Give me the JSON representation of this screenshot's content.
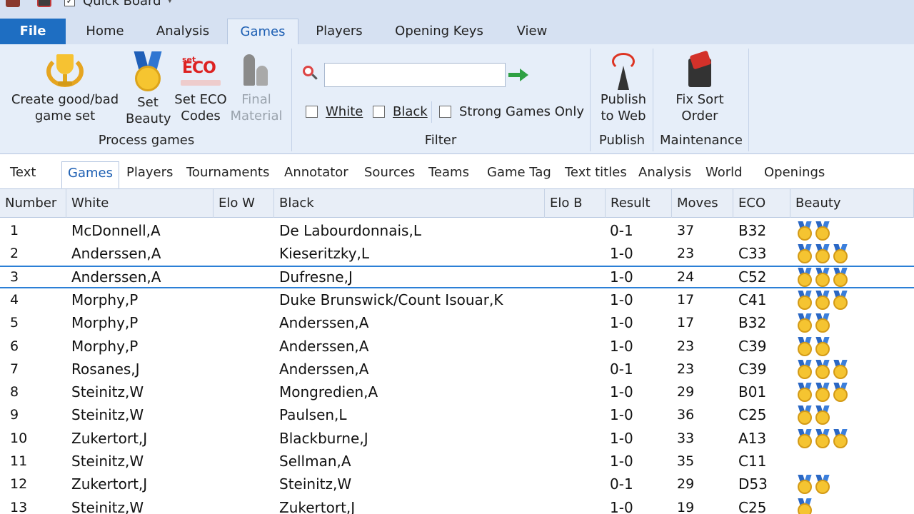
{
  "quick_access": {
    "label": "Quick Board",
    "checked": "✓"
  },
  "tabs": [
    {
      "label": "File"
    },
    {
      "label": "Home"
    },
    {
      "label": "Analysis"
    },
    {
      "label": "Games"
    },
    {
      "label": "Players"
    },
    {
      "label": "Opening Keys"
    },
    {
      "label": "View"
    }
  ],
  "ribbon": {
    "process_games": {
      "create_line1": "Create good/bad",
      "create_line2": "game set",
      "beauty_line1": "Set",
      "beauty_line2": "Beauty",
      "eco_line1": "Set ECO",
      "eco_line2": "Codes",
      "eco_icon_set": "set",
      "eco_icon_eco": "ECO",
      "final_line1": "Final",
      "final_line2": "Material",
      "group_label": "Process games"
    },
    "filter": {
      "search_value": "",
      "white_label": "White",
      "black_label": "Black",
      "strong_label": "Strong Games Only",
      "group_label": "Filter"
    },
    "publish": {
      "line1": "Publish",
      "line2": "to Web",
      "group_label": "Publish"
    },
    "maintenance": {
      "line1": "Fix Sort",
      "line2": "Order",
      "group_label": "Maintenance"
    }
  },
  "subtabs": [
    {
      "label": "Text"
    },
    {
      "label": "Games"
    },
    {
      "label": "Players"
    },
    {
      "label": "Tournaments"
    },
    {
      "label": "Annotator"
    },
    {
      "label": "Sources"
    },
    {
      "label": "Teams"
    },
    {
      "label": "Game Tag"
    },
    {
      "label": "Text titles"
    },
    {
      "label": "Analysis"
    },
    {
      "label": "World"
    },
    {
      "label": "Openings"
    }
  ],
  "table": {
    "columns": [
      "Number",
      "White",
      "Elo W",
      "Black",
      "Elo B",
      "Result",
      "Moves",
      "ECO",
      "Beauty"
    ],
    "rows": [
      {
        "number": "1",
        "white": "McDonnell,A",
        "black": "De Labourdonnais,L",
        "result": "0-1",
        "moves": "37",
        "eco": "B32",
        "beauty": 2
      },
      {
        "number": "2",
        "white": "Anderssen,A",
        "black": "Kieseritzky,L",
        "result": "1-0",
        "moves": "23",
        "eco": "C33",
        "beauty": 3
      },
      {
        "number": "3",
        "white": "Anderssen,A",
        "black": "Dufresne,J",
        "result": "1-0",
        "moves": "24",
        "eco": "C52",
        "beauty": 3
      },
      {
        "number": "4",
        "white": "Morphy,P",
        "black": "Duke Brunswick/Count Isouar,K",
        "result": "1-0",
        "moves": "17",
        "eco": "C41",
        "beauty": 3
      },
      {
        "number": "5",
        "white": "Morphy,P",
        "black": "Anderssen,A",
        "result": "1-0",
        "moves": "17",
        "eco": "B32",
        "beauty": 2
      },
      {
        "number": "6",
        "white": "Morphy,P",
        "black": "Anderssen,A",
        "result": "1-0",
        "moves": "23",
        "eco": "C39",
        "beauty": 2
      },
      {
        "number": "7",
        "white": "Rosanes,J",
        "black": "Anderssen,A",
        "result": "0-1",
        "moves": "23",
        "eco": "C39",
        "beauty": 3
      },
      {
        "number": "8",
        "white": "Steinitz,W",
        "black": "Mongredien,A",
        "result": "1-0",
        "moves": "29",
        "eco": "B01",
        "beauty": 3
      },
      {
        "number": "9",
        "white": "Steinitz,W",
        "black": "Paulsen,L",
        "result": "1-0",
        "moves": "36",
        "eco": "C25",
        "beauty": 2
      },
      {
        "number": "10",
        "white": "Zukertort,J",
        "black": "Blackburne,J",
        "result": "1-0",
        "moves": "33",
        "eco": "A13",
        "beauty": 3
      },
      {
        "number": "11",
        "white": "Steinitz,W",
        "black": "Sellman,A",
        "result": "1-0",
        "moves": "35",
        "eco": "C11",
        "beauty": 0
      },
      {
        "number": "12",
        "white": "Zukertort,J",
        "black": "Steinitz,W",
        "result": "0-1",
        "moves": "29",
        "eco": "D53",
        "beauty": 2
      },
      {
        "number": "13",
        "white": "Steinitz,W",
        "black": "Zukertort,J",
        "result": "1-0",
        "moves": "19",
        "eco": "C25",
        "beauty": 1
      }
    ]
  },
  "colors": {
    "accent": "#1e6ec2",
    "ribbon_bg": "#e6eef9",
    "selection": "#2b7fd6",
    "medal_gold": "#f5c431"
  }
}
